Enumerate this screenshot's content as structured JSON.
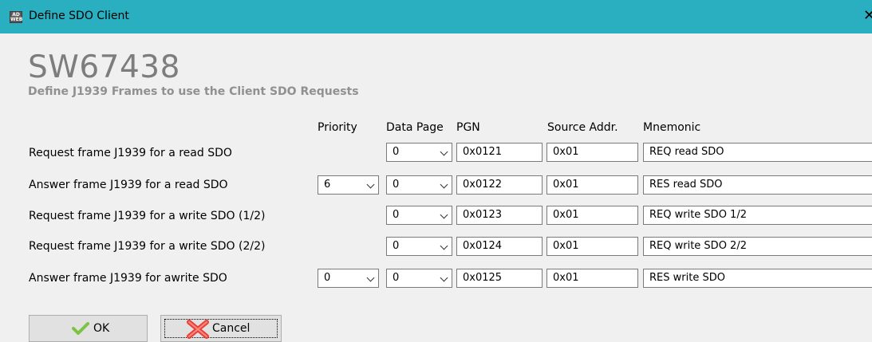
{
  "window": {
    "title": "Define SDO Client",
    "app_icon_text": "ADF\nWeb",
    "close_glyph": "✕"
  },
  "heading": {
    "title": "SW67438",
    "subtitle": "Define J1939 Frames to use the Client SDO Requests"
  },
  "columns": {
    "priority": "Priority",
    "data_page": "Data Page",
    "pgn": "PGN",
    "source_addr": "Source Addr.",
    "mnemonic": "Mnemonic"
  },
  "rows": [
    {
      "label": "Request frame J1939 for a read SDO",
      "priority": null,
      "data_page": "0",
      "pgn": "0x0121",
      "source_addr": "0x01",
      "mnemonic": "REQ read SDO"
    },
    {
      "label": "Answer frame J1939 for a read SDO",
      "priority": "6",
      "data_page": "0",
      "pgn": "0x0122",
      "source_addr": "0x01",
      "mnemonic": "RES read SDO"
    },
    {
      "label": "Request frame J1939 for a write SDO (1/2)",
      "priority": null,
      "data_page": "0",
      "pgn": "0x0123",
      "source_addr": "0x01",
      "mnemonic": "REQ write SDO 1/2"
    },
    {
      "label": "Request frame J1939 for a write SDO (2/2)",
      "priority": null,
      "data_page": "0",
      "pgn": "0x0124",
      "source_addr": "0x01",
      "mnemonic": "REQ write SDO 2/2"
    },
    {
      "label": "Answer frame J1939 for awrite SDO",
      "priority": "0",
      "data_page": "0",
      "pgn": "0x0125",
      "source_addr": "0x01",
      "mnemonic": "RES write SDO"
    }
  ],
  "buttons": {
    "ok": "OK",
    "cancel": "Cancel"
  },
  "icons": {
    "ok": "check-icon",
    "cancel": "x-icon",
    "close": "close-icon"
  },
  "colors": {
    "titlebar": "#2aafc0",
    "heading": "#7d7d7d",
    "subheading": "#909090",
    "check": "#7cc243",
    "cross": "#e8413a"
  }
}
